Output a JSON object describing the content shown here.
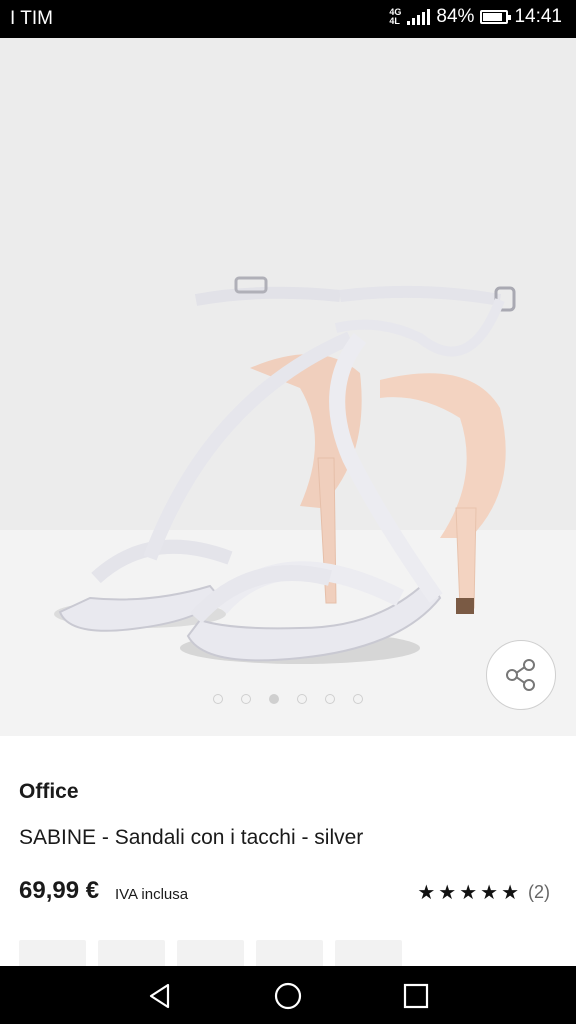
{
  "status_bar": {
    "carrier": "I TIM",
    "network_badge_top": "4G",
    "network_badge_bottom": "4L",
    "battery_percent": "84%",
    "battery_level": 0.84,
    "time": "14:41"
  },
  "gallery": {
    "image_count": 6,
    "active_index": 2,
    "share_icon": "share-icon"
  },
  "product": {
    "brand": "Office",
    "title": "SABINE - Sandali con i tacchi - silver",
    "price": "69,99 €",
    "vat_note": "IVA inclusa",
    "stars_display": "★★★★★",
    "rating_value": 5,
    "rating_count": "(2)"
  },
  "nav_bar": {
    "back_icon": "back-triangle-icon",
    "home_icon": "home-circle-icon",
    "recents_icon": "recents-square-icon"
  },
  "colors": {
    "status_bar_bg": "#000000",
    "gallery_bg": "#ececec",
    "text": "#1a1a1a"
  }
}
